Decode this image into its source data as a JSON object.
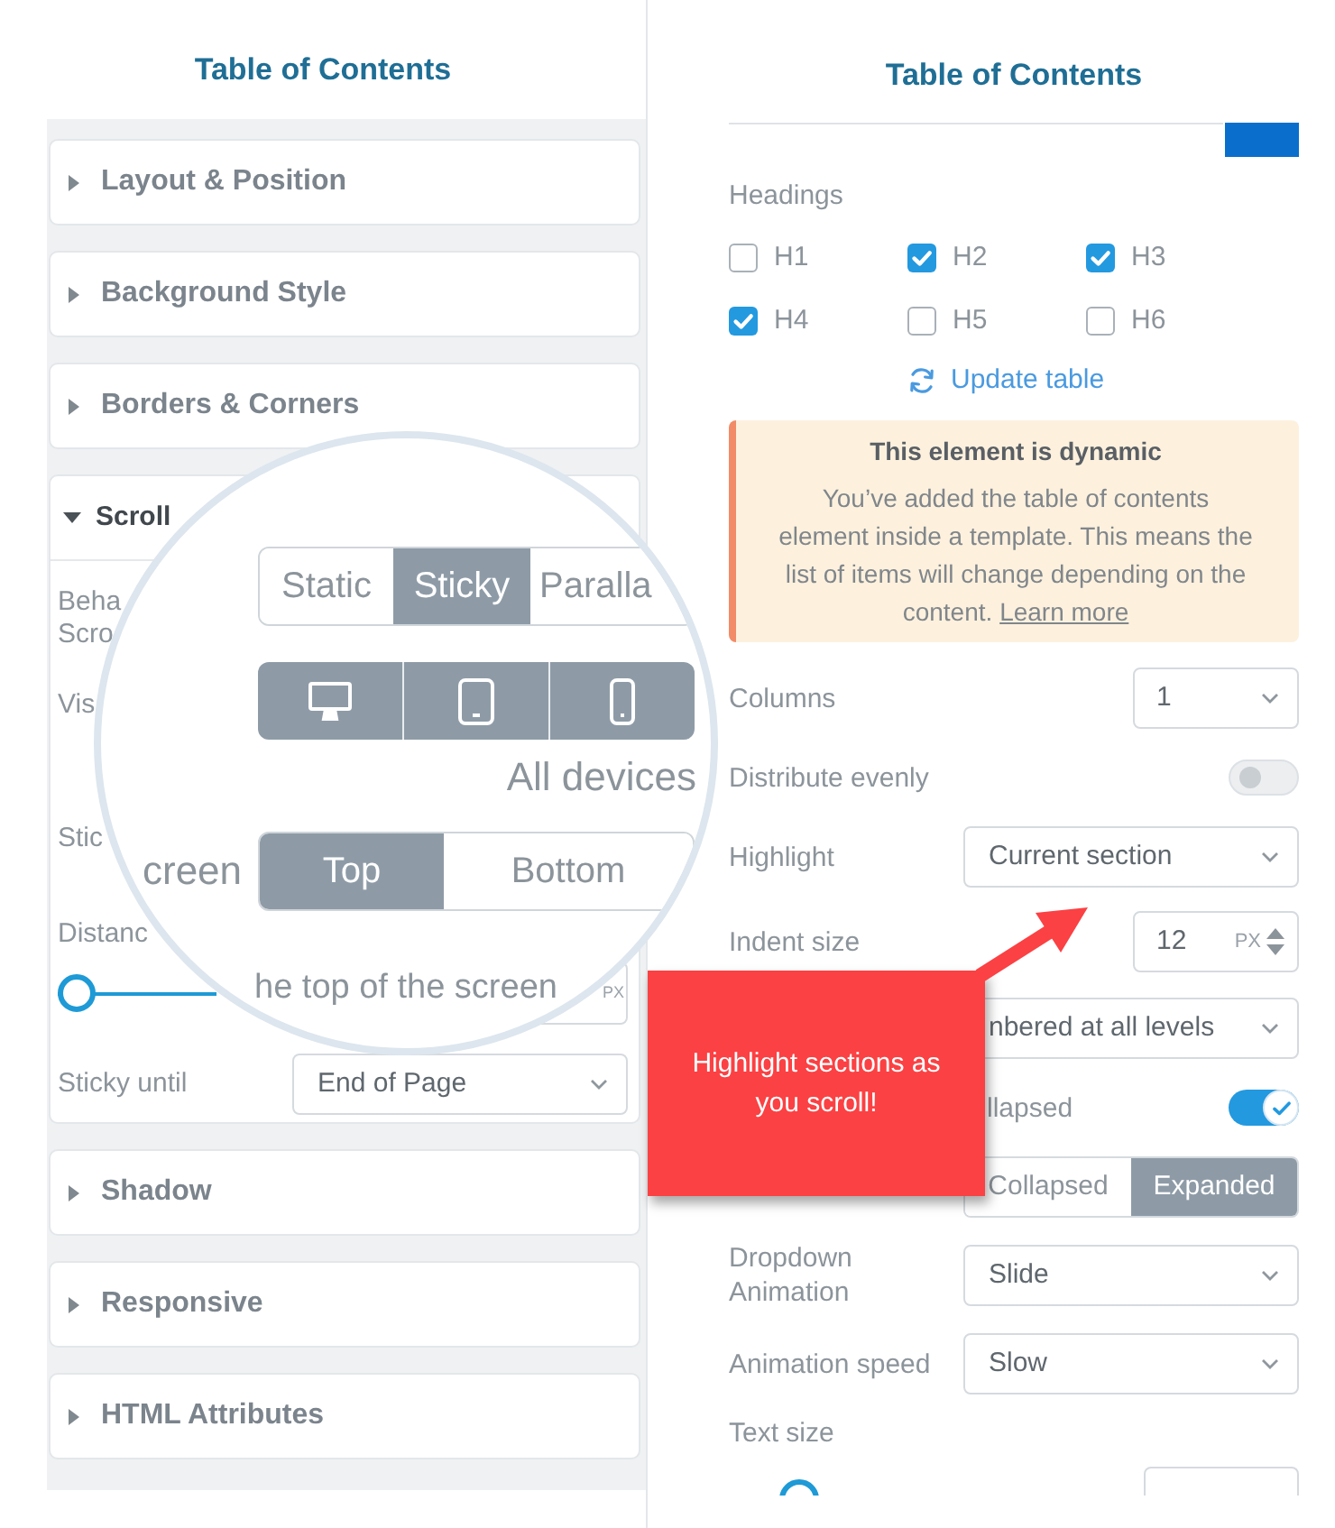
{
  "left_panel": {
    "title": "Table of Contents",
    "sections": [
      {
        "label": "Layout & Position",
        "expanded": false
      },
      {
        "label": "Background Style",
        "expanded": false
      },
      {
        "label": "Borders & Corners",
        "expanded": false
      },
      {
        "label": "Scroll",
        "expanded": true,
        "rows": [
          {
            "kind": "label",
            "lines": [
              "Beha",
              "Scro"
            ]
          },
          {
            "kind": "label",
            "lines": [
              "Vis"
            ]
          },
          {
            "kind": "label",
            "lines": [
              "Stic"
            ]
          },
          {
            "kind": "label",
            "lines": [
              "Distanc"
            ]
          },
          {
            "kind": "slider",
            "level": 0,
            "unit": "PX"
          },
          {
            "kind": "select",
            "label": "Sticky until",
            "value": "End of Page"
          }
        ]
      },
      {
        "label": "Shadow",
        "expanded": false
      },
      {
        "label": "Responsive",
        "expanded": false
      },
      {
        "label": "HTML Attributes",
        "expanded": false
      }
    ]
  },
  "magnifier": {
    "behavior_options": [
      {
        "label": "Static",
        "selected": false
      },
      {
        "label": "Sticky",
        "selected": true
      },
      {
        "label": "Paralla",
        "selected": false
      }
    ],
    "devices": [
      {
        "kind": "desktop",
        "selected": true
      },
      {
        "kind": "tablet",
        "selected": true
      },
      {
        "kind": "phone",
        "selected": true
      }
    ],
    "devices_caption": "All devices",
    "position_label": "creen",
    "position_options": [
      {
        "label": "Top",
        "selected": true
      },
      {
        "label": "Bottom",
        "selected": false
      }
    ],
    "distance_caption": "he top of the screen"
  },
  "right_panel": {
    "title": "Table of Contents",
    "headings_label": "Headings",
    "headings": [
      {
        "label": "H1",
        "checked": false
      },
      {
        "label": "H2",
        "checked": true
      },
      {
        "label": "H3",
        "checked": true
      },
      {
        "label": "H4",
        "checked": true
      },
      {
        "label": "H5",
        "checked": false
      },
      {
        "label": "H6",
        "checked": false
      }
    ],
    "update_link": "Update table",
    "notice": {
      "title": "This element is dynamic",
      "text_lines": [
        "You’ve added the table of contents",
        "element inside a template. This means the",
        "list of items will change depending on the",
        "content."
      ],
      "link": "Learn more"
    },
    "rows": [
      {
        "kind": "small_select",
        "label": "Columns",
        "value": "1"
      },
      {
        "kind": "toggle",
        "label": "Distribute evenly",
        "on": false
      },
      {
        "kind": "select",
        "label": "Highlight",
        "value": "Current section"
      },
      {
        "kind": "number",
        "label": "Indent size",
        "value": "12",
        "unit": "PX"
      },
      {
        "kind": "select",
        "value": "nbered at all levels"
      },
      {
        "kind": "toggle",
        "cut_label": "llapsed",
        "on": true
      },
      {
        "kind": "segmented",
        "options": [
          {
            "label": "Collapsed",
            "selected": false
          },
          {
            "label": "Expanded",
            "selected": true
          }
        ]
      },
      {
        "kind": "select",
        "label": "Dropdown Animation",
        "value": "Slide"
      },
      {
        "kind": "select",
        "label": "Animation speed",
        "value": "Slow"
      },
      {
        "kind": "slider",
        "label": "Text size"
      }
    ]
  },
  "callout": {
    "text": "Highlight sections as you scroll!"
  }
}
